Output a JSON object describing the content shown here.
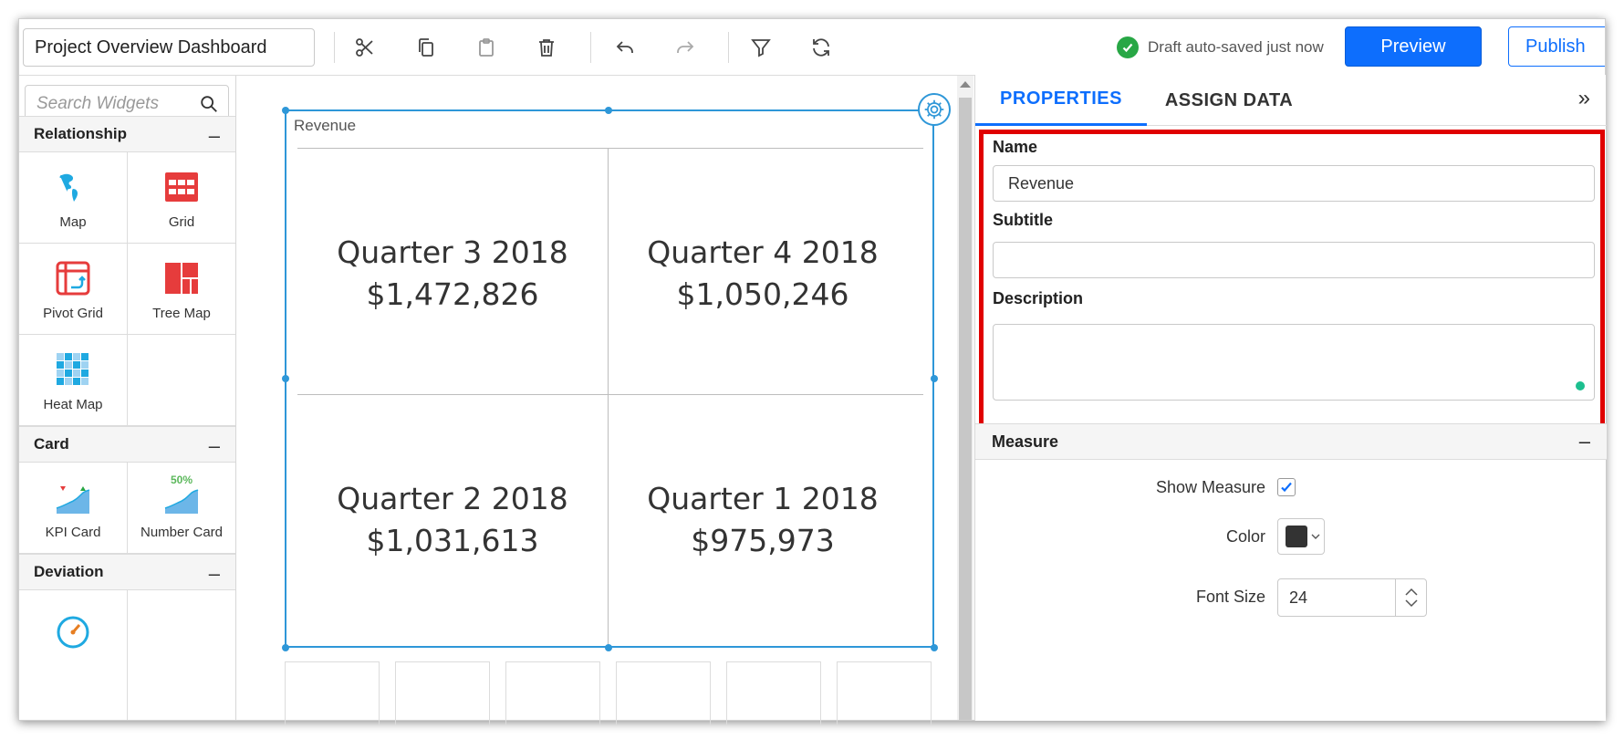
{
  "toolbar": {
    "dashboard_name": "Project Overview Dashboard",
    "save_status": "Draft auto-saved just now",
    "preview_label": "Preview",
    "publish_label": "Publish",
    "icons": [
      "cut-icon",
      "copy-icon",
      "paste-icon",
      "delete-icon",
      "undo-icon",
      "redo-icon",
      "filter-icon",
      "refresh-icon"
    ]
  },
  "widgets_panel": {
    "search_placeholder": "Search Widgets",
    "categories": [
      {
        "name": "Relationship",
        "items": [
          "Map",
          "Grid",
          "Pivot Grid",
          "Tree Map",
          "Heat Map"
        ]
      },
      {
        "name": "Card",
        "items": [
          "KPI Card",
          "Number Card"
        ]
      },
      {
        "name": "Deviation",
        "items": []
      }
    ],
    "number_card_badge": "50%"
  },
  "widget": {
    "title": "Revenue",
    "cells": [
      {
        "period": "Quarter 3 2018",
        "value": "$1,472,826"
      },
      {
        "period": "Quarter 4 2018",
        "value": "$1,050,246"
      },
      {
        "period": "Quarter 2 2018",
        "value": "$1,031,613"
      },
      {
        "period": "Quarter 1 2018",
        "value": "$975,973"
      }
    ]
  },
  "properties_panel": {
    "tabs": [
      "PROPERTIES",
      "ASSIGN DATA"
    ],
    "active_tab": "PROPERTIES",
    "name_label": "Name",
    "name_value": "Revenue",
    "subtitle_label": "Subtitle",
    "subtitle_value": "",
    "description_label": "Description",
    "description_value": "",
    "measure": {
      "section_title": "Measure",
      "show_measure_label": "Show Measure",
      "show_measure_checked": true,
      "color_label": "Color",
      "color_value": "#333333",
      "font_size_label": "Font Size",
      "font_size_value": "24"
    }
  },
  "colors": {
    "accent": "#0d6efd",
    "selection": "#2e97d8",
    "highlight_box": "#e00000",
    "success": "#28a745"
  }
}
